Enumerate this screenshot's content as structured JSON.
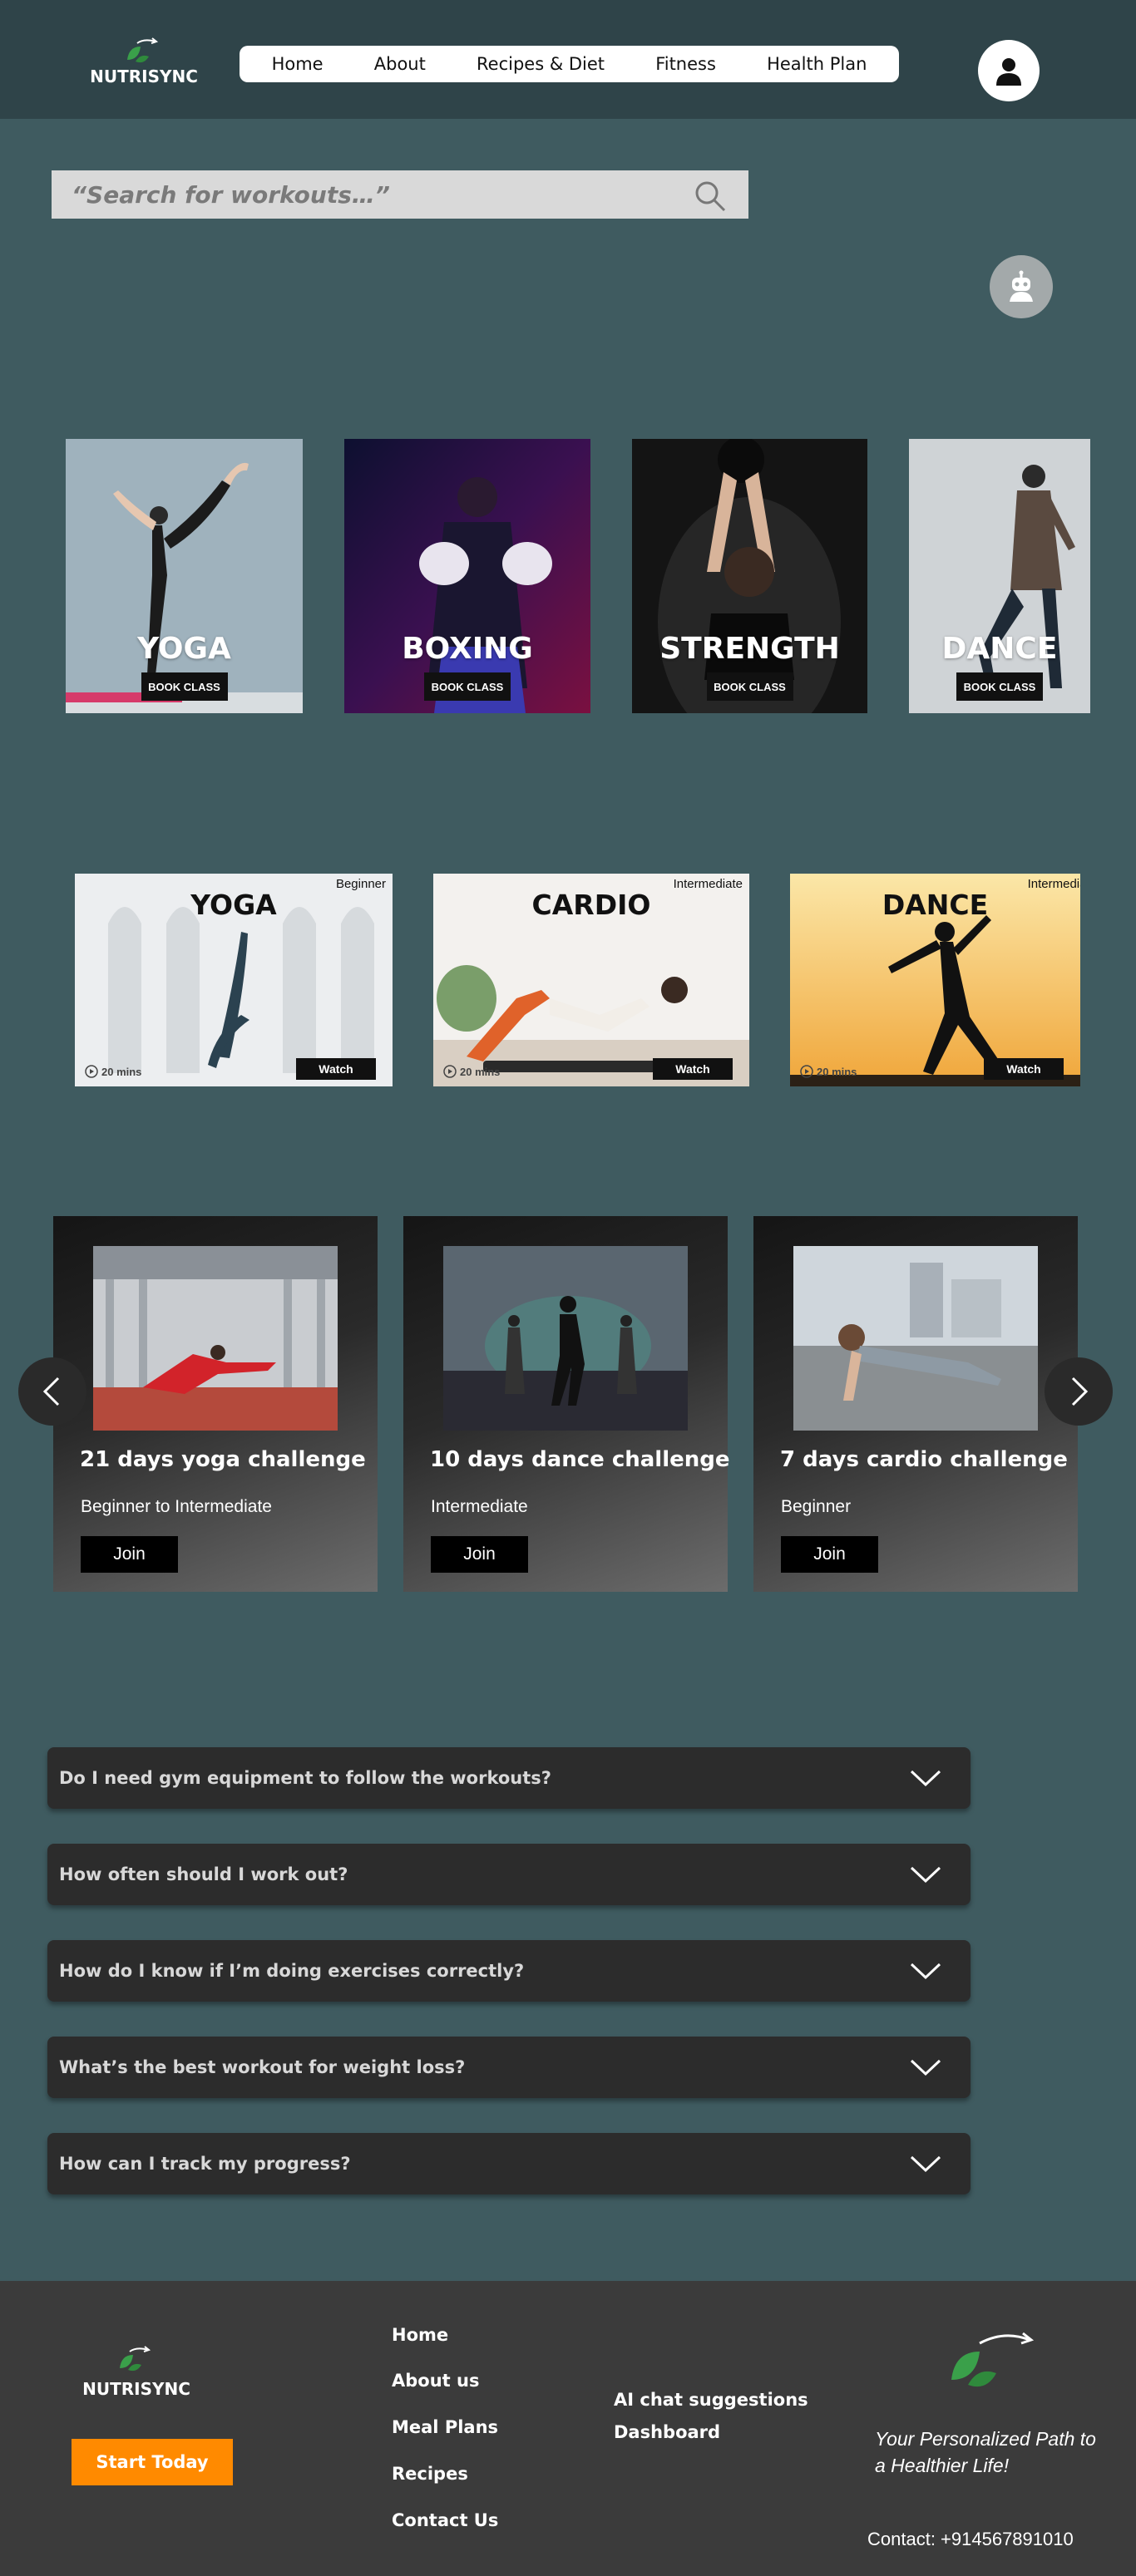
{
  "brand": {
    "name": "NUTRISYNC"
  },
  "nav": {
    "items": [
      "Home",
      "About",
      "Recipes & Diet",
      "Fitness",
      "Health Plan"
    ]
  },
  "search": {
    "placeholder": "“Search for workouts…”"
  },
  "classes": [
    {
      "title": "YOGA",
      "button": "BOOK CLASS"
    },
    {
      "title": "BOXING",
      "button": "BOOK CLASS"
    },
    {
      "title": "STRENGTH",
      "button": "BOOK CLASS"
    },
    {
      "title": "DANCE",
      "button": "BOOK CLASS"
    }
  ],
  "videos": [
    {
      "title": "YOGA",
      "level": "Beginner",
      "duration": "20 mins",
      "button": "Watch"
    },
    {
      "title": "CARDIO",
      "level": "Intermediate",
      "duration": "20 mins",
      "button": "Watch"
    },
    {
      "title": "DANCE",
      "level": "Intermediate",
      "duration": "20 mins",
      "button": "Watch"
    }
  ],
  "challenges": [
    {
      "title": "21 days yoga challenge",
      "level": "Beginner to Intermediate",
      "button": "Join"
    },
    {
      "title": "10 days dance challenge",
      "level": "Intermediate",
      "button": "Join"
    },
    {
      "title": "7 days cardio challenge",
      "level": "Beginner",
      "button": "Join"
    }
  ],
  "faq": [
    "Do I need gym equipment to follow the workouts?",
    "How often should I work out?",
    "How do I know if I’m doing exercises correctly?",
    "What’s the best workout for weight loss?",
    "How can I track my progress?"
  ],
  "footer": {
    "brand": "NUTRISYNC",
    "cta": "Start Today",
    "links": [
      "Home",
      "About us",
      "Meal Plans",
      "Recipes",
      "Contact Us"
    ],
    "links2": [
      "AI chat suggestions",
      "Dashboard"
    ],
    "tagline": "Your Personalized Path to a Healthier Life!",
    "contact": "Contact: +914567891010"
  },
  "colors": {
    "header": "#2f4449",
    "page": "#3f5b60",
    "footer": "#3b3b3b",
    "cta": "#ff8a00",
    "leaf": "#3aa04a"
  }
}
